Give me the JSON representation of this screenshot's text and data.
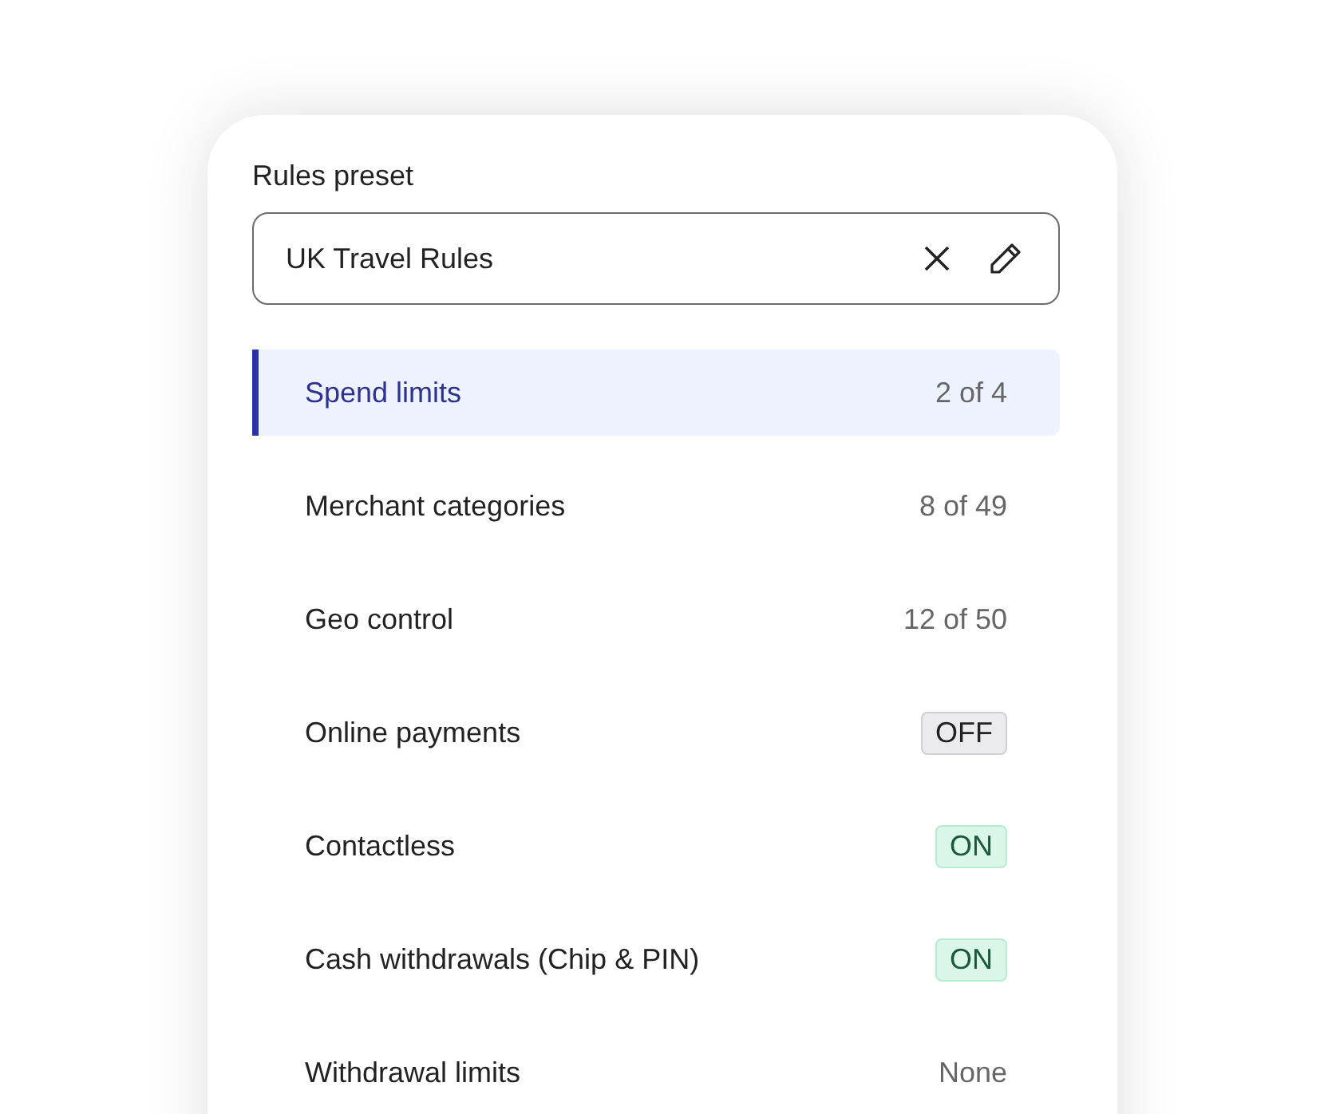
{
  "preset": {
    "label": "Rules preset",
    "value": "UK Travel Rules"
  },
  "rules": [
    {
      "name": "Spend limits",
      "kind": "count",
      "value": "2 of 4",
      "selected": true
    },
    {
      "name": "Merchant categories",
      "kind": "count",
      "value": "8 of 49",
      "selected": false
    },
    {
      "name": "Geo control",
      "kind": "count",
      "value": "12 of 50",
      "selected": false
    },
    {
      "name": "Online payments",
      "kind": "toggle",
      "value": "OFF",
      "on": false,
      "selected": false
    },
    {
      "name": "Contactless",
      "kind": "toggle",
      "value": "ON",
      "on": true,
      "selected": false
    },
    {
      "name": "Cash withdrawals (Chip & PIN)",
      "kind": "toggle",
      "value": "ON",
      "on": true,
      "selected": false
    },
    {
      "name": "Withdrawal limits",
      "kind": "count",
      "value": "None",
      "selected": false
    }
  ]
}
